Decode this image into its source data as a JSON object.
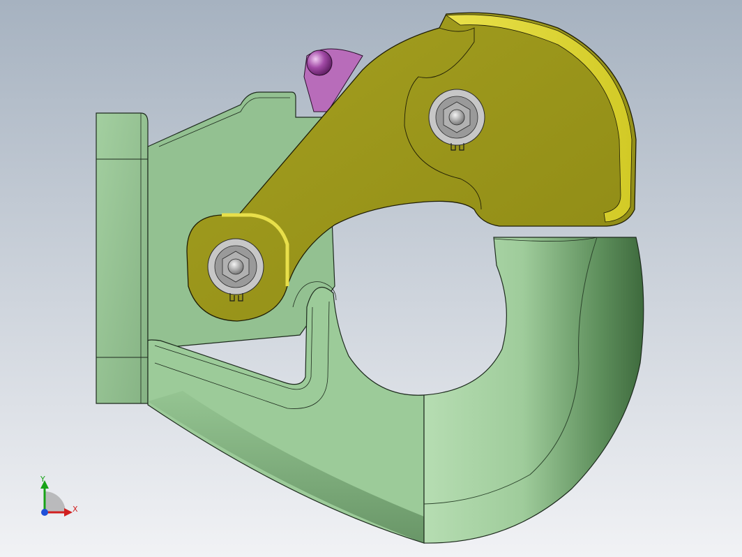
{
  "viewport": {
    "background_top": "#a7b3c1",
    "background_bottom": "#f2f3f6"
  },
  "model": {
    "body_color": "#98c596",
    "latch_color": "#c9c22c",
    "lever_color": "#c77bc9",
    "fastener_color": "#b8b8b8"
  },
  "triad": {
    "x_label": "X",
    "y_label": "Y",
    "x_color": "#d11f1f",
    "y_color": "#17a317",
    "z_color": "#1f4fd8"
  }
}
